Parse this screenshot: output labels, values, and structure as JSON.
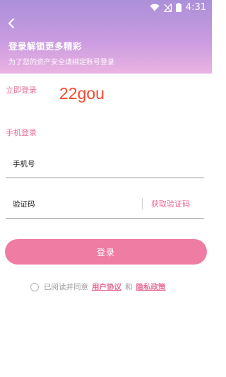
{
  "status": {
    "time": "4:31"
  },
  "header": {
    "title": "登录解锁更多精彩",
    "subtitle": "为了您的资产安全请绑定账号登录"
  },
  "section": {
    "login_now": "立即登录",
    "watermark": "22gou",
    "phone_login": "手机登录"
  },
  "form": {
    "phone_label": "手机号",
    "code_label": "验证码",
    "get_code": "获取验证码"
  },
  "actions": {
    "login": "登录"
  },
  "agreement": {
    "prefix": "已阅读并同意",
    "user_agreement": "用户协议",
    "and": "和",
    "privacy_policy": "隐私政策"
  },
  "colors": {
    "header_start": "#ab90d9",
    "header_end": "#eab3e1",
    "accent": "#e86e96",
    "button": "#ef7ca3"
  }
}
